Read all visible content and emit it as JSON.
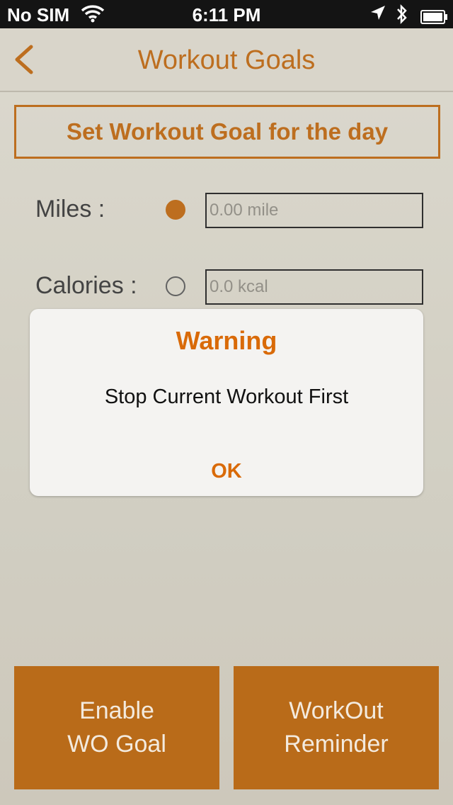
{
  "status_bar": {
    "carrier": "No SIM",
    "time": "6:11 PM",
    "icons": [
      "wifi-icon",
      "location-icon",
      "bluetooth-icon",
      "battery-icon"
    ]
  },
  "nav": {
    "title": "Workout Goals",
    "back_icon": "chevron-left-icon"
  },
  "goal": {
    "header": "Set Workout Goal for the day",
    "options": [
      {
        "label": "Miles :",
        "selected": true,
        "placeholder": "0.00 mile"
      },
      {
        "label": "Calories :",
        "selected": false,
        "placeholder": "0.0 kcal"
      }
    ]
  },
  "buttons": {
    "enable_line1": "Enable",
    "enable_line2": "WO Goal",
    "reminder_line1": "WorkOut",
    "reminder_line2": "Reminder"
  },
  "alert": {
    "title": "Warning",
    "message": "Stop Current Workout First",
    "ok": "OK"
  },
  "colors": {
    "accent": "#b8620c",
    "button_bg": "#b45f06",
    "alert_accent": "#d96a08"
  }
}
